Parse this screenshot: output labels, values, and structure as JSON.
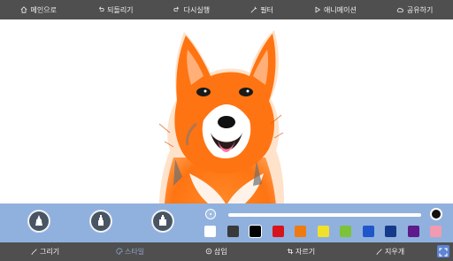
{
  "top_menu": [
    {
      "label": "메인으로",
      "icon": "home-icon"
    },
    {
      "label": "되돌리기",
      "icon": "undo-icon"
    },
    {
      "label": "다시실행",
      "icon": "redo-icon"
    },
    {
      "label": "필터",
      "icon": "magic-wand-icon"
    },
    {
      "label": "애니메이션",
      "icon": "play-icon"
    },
    {
      "label": "공유하기",
      "icon": "cloud-icon"
    }
  ],
  "bottom_tabs": [
    {
      "label": "그리기",
      "icon": "pencil-icon",
      "active": false
    },
    {
      "label": "스타일",
      "icon": "palette-icon",
      "active": true
    },
    {
      "label": "삽입",
      "icon": "insert-circle-icon",
      "active": false
    },
    {
      "label": "자르기",
      "icon": "crop-icon",
      "active": false
    },
    {
      "label": "지우개",
      "icon": "eraser-icon",
      "active": false
    }
  ],
  "brushes": [
    {
      "name": "brush-style-1",
      "icon": "paint-brush-icon"
    },
    {
      "name": "brush-style-2",
      "icon": "marker-icon"
    },
    {
      "name": "brush-style-3",
      "icon": "ink-bottle-icon"
    }
  ],
  "brush_size": {
    "level": 0.95
  },
  "palette": {
    "colors": [
      "#ffffff",
      "#3a3a3a",
      "#000000",
      "#d7141b",
      "#f07a12",
      "#f2e12a",
      "#7cc23a",
      "#1f56c9",
      "#163a8a",
      "#5c1a8a",
      "#f29ab0"
    ],
    "selected_index": 2
  },
  "accent_colors": {
    "toolbar_bg": "#4f4f4f",
    "panel_bg": "#78a0d7",
    "active_tab": "#8fa3c8",
    "fullscreen_button": "#5d84d6",
    "dog_orange": "#ff7a1a"
  },
  "fullscreen_icon": "fullscreen-icon"
}
